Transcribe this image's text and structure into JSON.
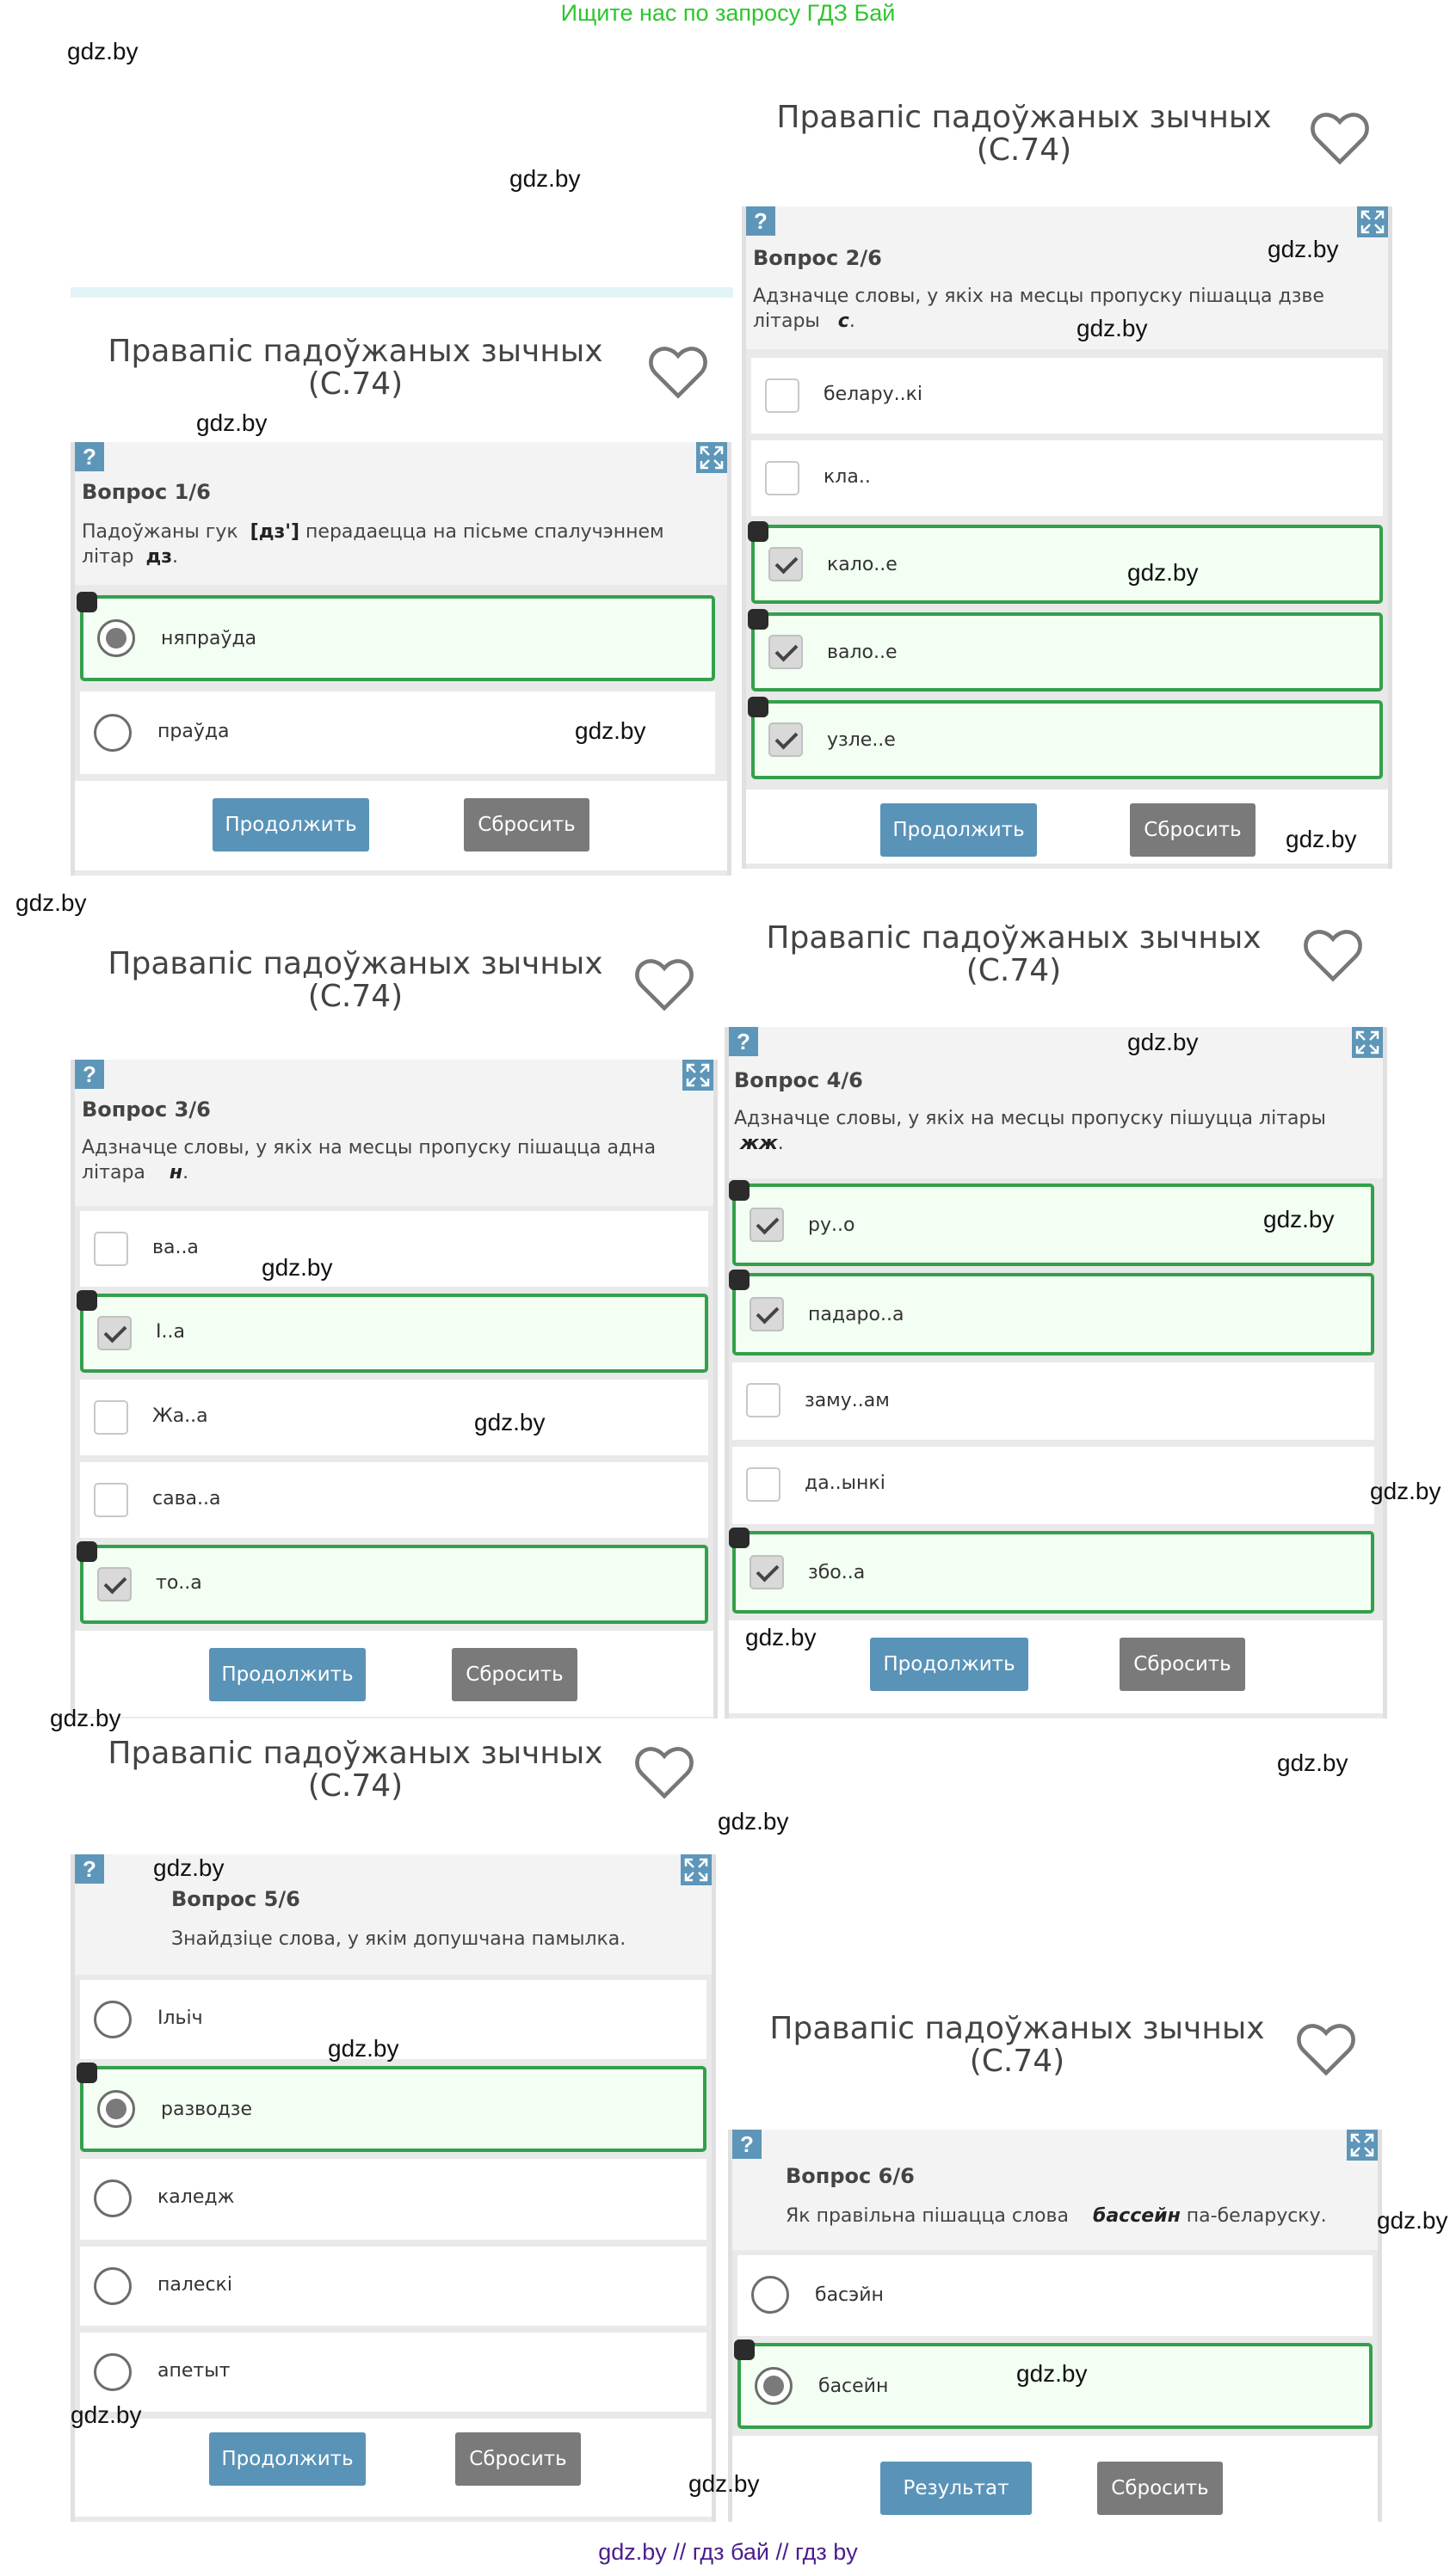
{
  "banner": "Ищите нас по запросу ГДЗ Бай",
  "footer": "gdz.by  //  гдз бай  //  гдз by",
  "watermark": "gdz.by",
  "quizzes": {
    "q1": {
      "title_line1": "Правапіс падоўжаных зычных",
      "title_line2": "(С.74)",
      "help": "?",
      "number": "Вопрос 1/6",
      "text_pre": "Падоўжаны гук",
      "text_bold": "[дз']",
      "text_post": "перадаецца на пісьме спалучэннем",
      "text_line2_pre": "літар",
      "text_line2_bold": "дз",
      "text_line2_post": ".",
      "options": [
        "няпраўда",
        "праўда"
      ],
      "continue": "Продолжить",
      "reset": "Сбросить"
    },
    "q2": {
      "title_line1": "Правапіс падоўжаных зычных",
      "title_line2": "(С.74)",
      "help": "?",
      "number": "Вопрос 2/6",
      "text_line1": "Адзначце словы, у якіх на месцы пропуску пішацца дзве",
      "text_line2_pre": "літары",
      "text_line2_bold": "с",
      "text_line2_post": ".",
      "options": [
        "белару..кі",
        "кла..",
        "кало..е",
        "вало..е",
        "узле..е"
      ],
      "continue": "Продолжить",
      "reset": "Сбросить"
    },
    "q3": {
      "title_line1": "Правапіс падоўжаных зычных",
      "title_line2": "(С.74)",
      "help": "?",
      "number": "Вопрос 3/6",
      "text_line1": "Адзначце словы, у якіх на месцы пропуску пішацца адна",
      "text_line2_pre": "літара",
      "text_line2_bold": "н",
      "text_line2_post": ".",
      "options": [
        "ва..а",
        "І..а",
        "Жа..а",
        "сава..а",
        "то..а"
      ],
      "continue": "Продолжить",
      "reset": "Сбросить"
    },
    "q4": {
      "title_line1": "Правапіс падоўжаных зычных",
      "title_line2": "(С.74)",
      "help": "?",
      "number": "Вопрос 4/6",
      "text_line1": "Адзначце словы, у якіх на месцы пропуску пішуцца літары",
      "text_line2_bold": "жж",
      "text_line2_post": ".",
      "options": [
        "ру..о",
        "падаро..а",
        "заму..ам",
        "да..ынкі",
        "збо..а"
      ],
      "continue": "Продолжить",
      "reset": "Сбросить"
    },
    "q5": {
      "title_line1": "Правапіс падоўжаных зычных",
      "title_line2": "(С.74)",
      "help": "?",
      "number": "Вопрос 5/6",
      "text_line1": "Знайдзіце слова, у якім допушчана памылка.",
      "options": [
        "Ільіч",
        "разводзе",
        "каледж",
        "палескі",
        "апетыт"
      ],
      "continue": "Продолжить",
      "reset": "Сбросить"
    },
    "q6": {
      "title_line1": "Правапіс падоўжаных зычных",
      "title_line2": "(С.74)",
      "help": "?",
      "number": "Вопрос 6/6",
      "text_pre": "Як правільна пішацца слова",
      "text_bold": "бассейн",
      "text_post": "па-беларуску.",
      "options": [
        "басэйн",
        "басейн"
      ],
      "result": "Результат",
      "reset": "Сбросить"
    }
  }
}
